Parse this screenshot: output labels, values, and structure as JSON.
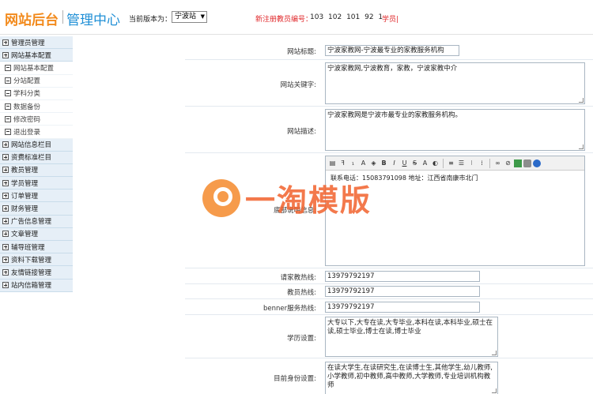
{
  "header": {
    "logo_text": "网站后台",
    "mgr_text": "管理中心",
    "version_label": "当前版本为：",
    "version_value": "宁波站",
    "reg_label": "新注册教员编号：",
    "reg_numbers": "103  102  101  92  1",
    "reg_student": "学员|"
  },
  "sidebar": {
    "items": [
      {
        "label": "管理员管理",
        "type": "plus"
      },
      {
        "label": "网站基本配置",
        "type": "plus"
      },
      {
        "label": "网站基本配置",
        "type": "sub"
      },
      {
        "label": "分站配置",
        "type": "sub"
      },
      {
        "label": "学科分类",
        "type": "sub"
      },
      {
        "label": "数据备份",
        "type": "sub"
      },
      {
        "label": "修改密码",
        "type": "sub"
      },
      {
        "label": "退出登录",
        "type": "sub"
      },
      {
        "label": "网站信息栏目",
        "type": "plus"
      },
      {
        "label": "资费标准栏目",
        "type": "plus"
      },
      {
        "label": "教员管理",
        "type": "plus"
      },
      {
        "label": "学员管理",
        "type": "plus"
      },
      {
        "label": "订单管理",
        "type": "plus"
      },
      {
        "label": "财务管理",
        "type": "plus"
      },
      {
        "label": "广告信息管理",
        "type": "plus"
      },
      {
        "label": "文章管理",
        "type": "plus"
      },
      {
        "label": "辅导班管理",
        "type": "plus"
      },
      {
        "label": "资料下载管理",
        "type": "plus"
      },
      {
        "label": "友情链接管理",
        "type": "plus"
      },
      {
        "label": "站内信箱管理",
        "type": "plus"
      }
    ]
  },
  "form": {
    "site_title_label": "网站标题:",
    "site_title_value": "宁波家教网-宁波最专业的家教服务机构",
    "keywords_label": "网站关键字:",
    "keywords_value": "宁波家教网,宁波教育，家教，宁波家教中介",
    "desc_label": "网站描述:",
    "desc_value": "宁波家教网是宁波市最专业的家教服务机构。",
    "footer_label": "底部说明信息:",
    "footer_value": "联系电话：15083791098    地址：江西省南康市北门",
    "hotline_label": "请家教热线:",
    "hotline_value": "13979792197",
    "teacher_hotline_label": "教员热线:",
    "teacher_hotline_value": "13979792197",
    "banner_hotline_label": "benner服务热线:",
    "banner_hotline_value": "13979792197",
    "education_label": "学历设置:",
    "education_value": "大专以下,大专在读,大专毕业,本科在读,本科毕业,硕士在读,硕士毕业,博士在读,博士毕业",
    "identity_label": "目前身份设置:",
    "identity_value": "在读大学生,在读研究生,在读博士生,其他学生,幼儿教师,小学教师,初中教师,高中教师,大学教师,专业培训机构教师"
  },
  "watermark": {
    "text": "一淘模版"
  },
  "colors": {
    "logo": "#f28a1c",
    "mgr": "#1f8fd6",
    "red": "#e0282b",
    "sidebar_bg": "#e6eff7"
  }
}
